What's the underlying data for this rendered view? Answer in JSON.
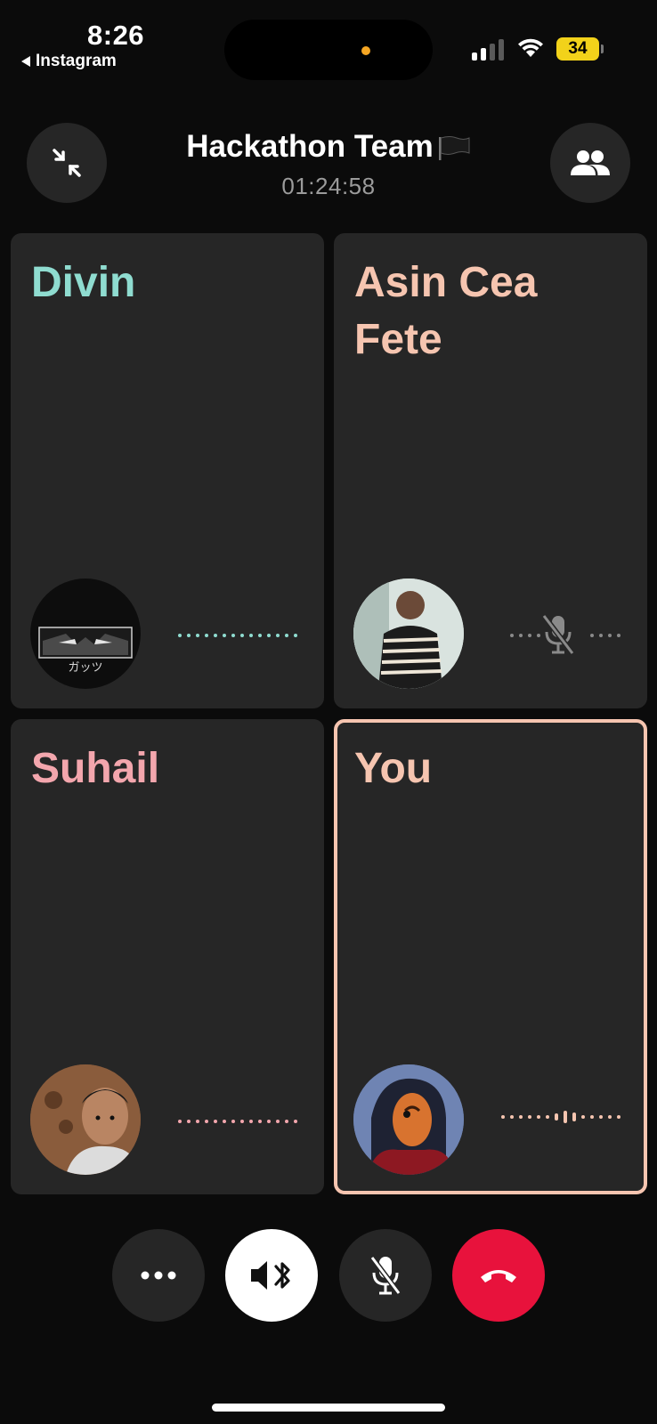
{
  "status_bar": {
    "time": "8:26",
    "back_app": "Instagram",
    "battery": "34",
    "battery_color": "#f2d21a",
    "icons": [
      "cellular-signal-icon",
      "wifi-icon",
      "battery-icon"
    ]
  },
  "header": {
    "title": "Hackathon Team",
    "call_timer": "01:24:58",
    "left_button_icon": "minimize-icon",
    "right_button_icon": "participants-icon"
  },
  "participants": [
    {
      "name": "Divin",
      "color": "#8fdcd0",
      "muted": false,
      "speaking": false
    },
    {
      "name": "Asin Cea Fete",
      "color": "#f6c5b0",
      "muted": true,
      "speaking": false
    },
    {
      "name": "Suhail",
      "color": "#f3a6ad",
      "muted": false,
      "speaking": false
    },
    {
      "name": "You",
      "color": "#f6c5b0",
      "muted": false,
      "speaking": true,
      "active": true
    }
  ],
  "avatar_text": {
    "divin": "ガッツ"
  },
  "controls": [
    {
      "icon": "more-icon",
      "style": "dark"
    },
    {
      "icon": "bluetooth-speaker-icon",
      "style": "light"
    },
    {
      "icon": "mic-off-icon",
      "style": "dark"
    },
    {
      "icon": "end-call-icon",
      "style": "red",
      "color": "#e8123c"
    }
  ]
}
